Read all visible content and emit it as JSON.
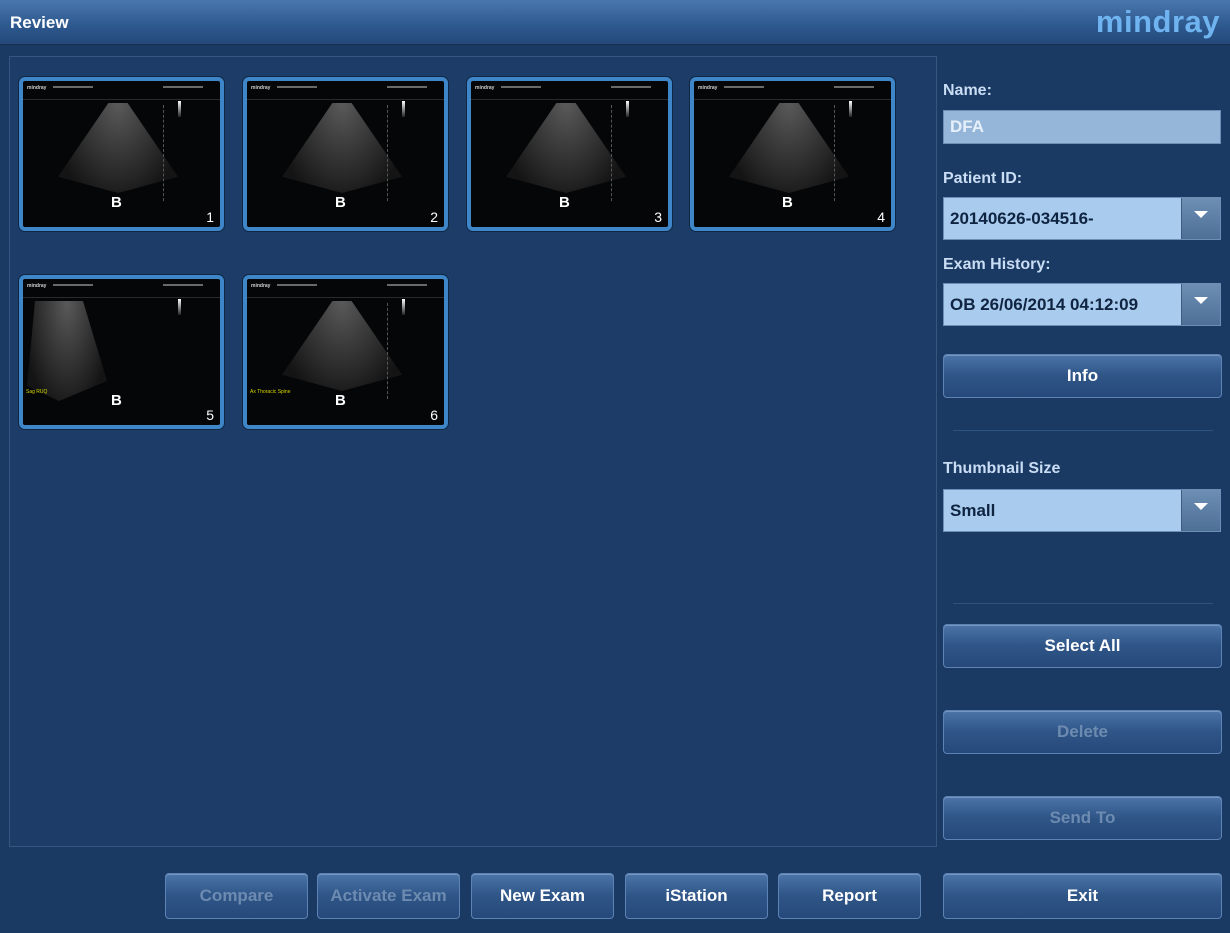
{
  "header": {
    "title": "Review",
    "logo": "mindray"
  },
  "thumbnails": [
    {
      "number": "1",
      "mode": "B"
    },
    {
      "number": "2",
      "mode": "B"
    },
    {
      "number": "3",
      "mode": "B"
    },
    {
      "number": "4",
      "mode": "B"
    },
    {
      "number": "5",
      "mode": "B",
      "annotation": "Sag RUQ"
    },
    {
      "number": "6",
      "mode": "B",
      "annotation": "Ax Thoracic Spine"
    }
  ],
  "thumbnail_brand": "mindray",
  "side_panel": {
    "name_label": "Name:",
    "name_value": "DFA",
    "patient_id_label": "Patient ID:",
    "patient_id_value": "20140626-034516-",
    "exam_history_label": "Exam History:",
    "exam_history_value": "OB 26/06/2014 04:12:09",
    "info_button": "Info",
    "thumbnail_size_label": "Thumbnail Size",
    "thumbnail_size_value": "Small",
    "select_all_button": "Select All",
    "delete_button": "Delete",
    "send_to_button": "Send To",
    "exit_button": "Exit"
  },
  "bottom_bar": {
    "compare": "Compare",
    "activate_exam": "Activate Exam",
    "new_exam": "New Exam",
    "istation": "iStation",
    "report": "Report"
  },
  "colors": {
    "background": "#1b3a63",
    "accent": "#3f86c8",
    "logo": "#6fb4f0"
  }
}
